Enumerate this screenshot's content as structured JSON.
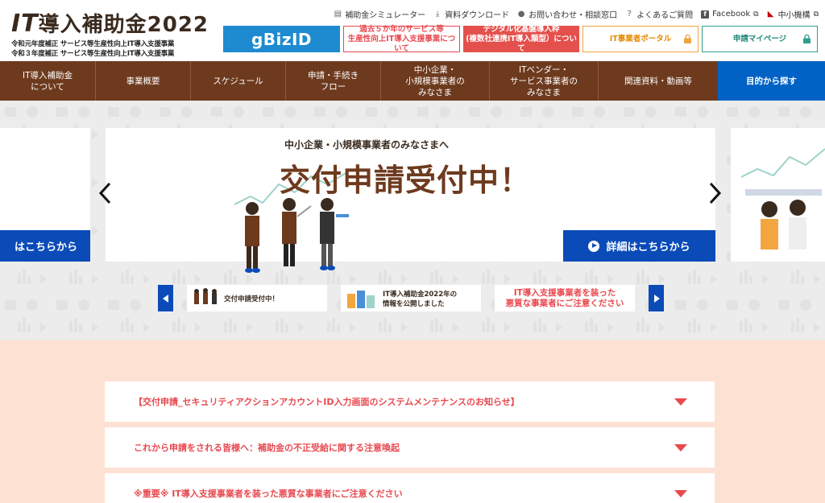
{
  "logo": {
    "title_it": "IT",
    "title_rest": "導入補助金2022",
    "sub1": "令和元年度補正 サービス等生産性向上IT導入支援事業",
    "sub2": "令和３年度補正 サービス等生産性向上IT導入支援事業"
  },
  "toplinks": [
    {
      "label": "補助金シミュレーター",
      "icon": "calculator-icon"
    },
    {
      "label": "資料ダウンロード",
      "icon": "download-icon"
    },
    {
      "label": "お問い合わせ・相談窓口",
      "icon": "person-icon"
    },
    {
      "label": "よくあるご質問",
      "icon": "question-icon"
    },
    {
      "label": "Facebook",
      "icon": "facebook-icon"
    },
    {
      "label": "中小機構",
      "icon": "smrj-logo-icon"
    }
  ],
  "buttons": {
    "gbiz": "gBizID",
    "past_line1": "過去５か年のサービス等",
    "past_line2": "生産性向上IT導入支援事業について",
    "digital_line1": "デジタル化基盤導入枠",
    "digital_line2": "(複数社連携IT導入類型）について",
    "portal": "IT事業者ポータル",
    "mypage": "申請マイページ"
  },
  "nav": [
    {
      "line1": "IT導入補助金",
      "line2": "について"
    },
    {
      "line1": "事業概要",
      "line2": ""
    },
    {
      "line1": "スケジュール",
      "line2": ""
    },
    {
      "line1": "申請・手続き",
      "line2": "フロー"
    },
    {
      "line1": "中小企業・",
      "line2": "小規模事業者の",
      "line3": "みなさま"
    },
    {
      "line1": "ITベンダー・",
      "line2": "サービス事業者の",
      "line3": "みなさま"
    },
    {
      "line1": "関連資料・動画等",
      "line2": ""
    },
    {
      "line1": "目的から探す",
      "line2": ""
    }
  ],
  "hero": {
    "subtitle": "中小企業・小規模事業者のみなさまへ",
    "title": "交付申請受付中！",
    "detail_button": "詳細はこちらから",
    "detail_button_left": "はこちらから",
    "thumb1": "交付申請受付中！",
    "thumb2_line1": "IT導入補助金2022年の",
    "thumb2_line2": "情報を公開しました",
    "thumb3_line1": "IT導入支援事業者を装った",
    "thumb3_line2": "悪質な事業者にご注意ください"
  },
  "notices": [
    "【交付申請_セキュリティアクションアカウントID入力画面のシステムメンテナンスのお知らせ】",
    "これから申請をされる皆様へ：補助金の不正受給に関する注意喚起",
    "※重要※ IT導入支援事業者を装った悪質な事業者にご注意ください"
  ],
  "colors": {
    "nav_brown": "#6e3a1e",
    "nav_active": "#0062c4",
    "accent_red": "#e8494f",
    "detail_blue": "#0a4bb8",
    "notice_bg": "#fde2d4"
  }
}
